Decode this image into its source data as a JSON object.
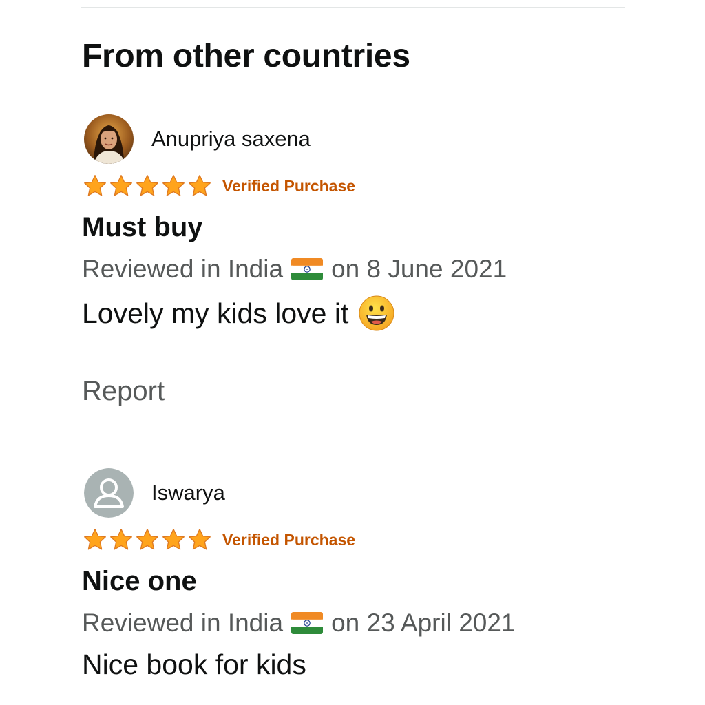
{
  "section": {
    "title": "From other countries"
  },
  "reviews": [
    {
      "reviewer_name": "Anupriya saxena",
      "avatar": "profile-photo",
      "rating": 5,
      "rating_max": 5,
      "badge": "Verified Purchase",
      "title": "Must buy",
      "meta_prefix": "Reviewed in India",
      "flag_icon": "india-flag-icon",
      "meta_suffix": "on 8 June 2021",
      "body": "Lovely my kids love it",
      "body_emoji": "grinning-face-emoji",
      "report_label": "Report"
    },
    {
      "reviewer_name": "Iswarya",
      "avatar": "default-avatar-icon",
      "rating": 5,
      "rating_max": 5,
      "badge": "Verified Purchase",
      "title": "Nice one",
      "meta_prefix": "Reviewed in India",
      "flag_icon": "india-flag-icon",
      "meta_suffix": "on 23 April 2021",
      "body": "Nice book for kids"
    }
  ],
  "colors": {
    "star": "#ffa41c",
    "star_stroke": "#de7921",
    "verified": "#c45500",
    "meta_text": "#565959",
    "primary_text": "#0f1111",
    "divider": "#e3e6e6",
    "default_avatar_bg": "#a9b3b3"
  }
}
